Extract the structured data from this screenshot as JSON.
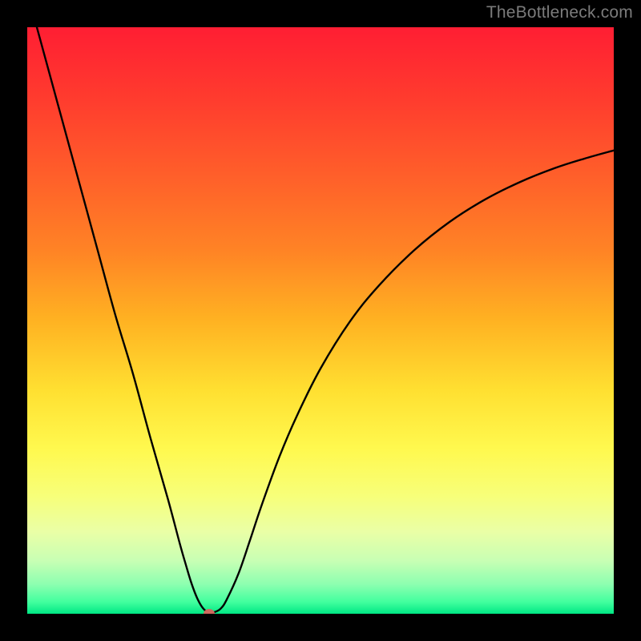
{
  "watermark": "TheBottleneck.com",
  "marker_color": "#cf6a5e",
  "colors": {
    "black": "#000000",
    "curve": "#000000"
  },
  "gradient_stops": [
    {
      "pct": 0,
      "color": "#ff1e33"
    },
    {
      "pct": 12,
      "color": "#ff3b2e"
    },
    {
      "pct": 25,
      "color": "#ff5e2a"
    },
    {
      "pct": 38,
      "color": "#ff8325"
    },
    {
      "pct": 50,
      "color": "#ffb222"
    },
    {
      "pct": 62,
      "color": "#ffe031"
    },
    {
      "pct": 72,
      "color": "#fff94f"
    },
    {
      "pct": 80,
      "color": "#f7ff7a"
    },
    {
      "pct": 86,
      "color": "#eaffa6"
    },
    {
      "pct": 91,
      "color": "#c8ffb4"
    },
    {
      "pct": 95,
      "color": "#8cffb0"
    },
    {
      "pct": 98,
      "color": "#42ff9e"
    },
    {
      "pct": 100,
      "color": "#00e784"
    }
  ],
  "chart_data": {
    "type": "line",
    "title": "",
    "xlabel": "",
    "ylabel": "",
    "xlim": [
      0,
      100
    ],
    "ylim": [
      0,
      100
    ],
    "grid": false,
    "legend": false,
    "marker_point": {
      "x": 31,
      "y": 0
    },
    "series": [
      {
        "name": "bottleneck-curve",
        "x": [
          0,
          3,
          6,
          9,
          12,
          15,
          18,
          21,
          24,
          26,
          27,
          28,
          29,
          30,
          31,
          32,
          33,
          34,
          36,
          38,
          40,
          43,
          46,
          50,
          55,
          60,
          66,
          72,
          78,
          84,
          90,
          95,
          100
        ],
        "y": [
          106,
          95,
          84,
          73,
          62,
          51,
          41,
          30,
          19.5,
          12,
          8.5,
          5.2,
          2.6,
          0.9,
          0.2,
          0.3,
          0.9,
          2.4,
          6.8,
          12.6,
          18.6,
          26.8,
          33.8,
          41.8,
          49.8,
          56.0,
          62.0,
          66.8,
          70.6,
          73.6,
          76.0,
          77.6,
          79.0
        ]
      }
    ]
  }
}
